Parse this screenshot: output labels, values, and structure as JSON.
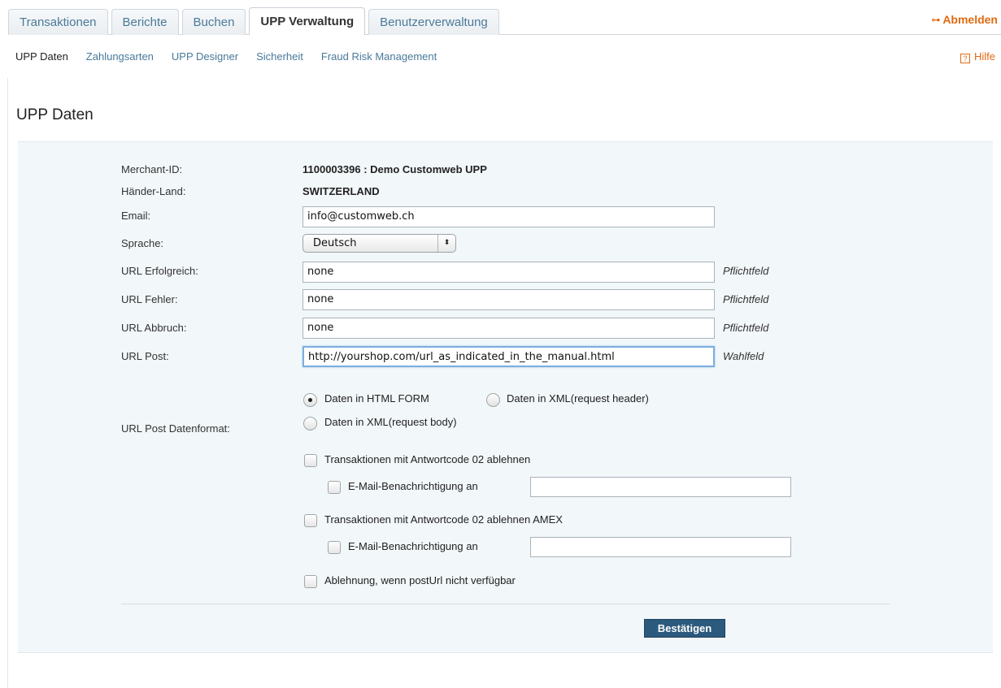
{
  "tabs": [
    "Transaktionen",
    "Berichte",
    "Buchen",
    "UPP Verwaltung",
    "Benutzerverwaltung"
  ],
  "active_tab": "UPP Verwaltung",
  "logout_label": "Abmelden",
  "subnav": [
    "UPP Daten",
    "Zahlungsarten",
    "UPP Designer",
    "Sicherheit",
    "Fraud Risk Management"
  ],
  "active_subnav": "UPP Daten",
  "help_label": "Hilfe",
  "page_title": "UPP Daten",
  "form": {
    "merchant_id_label": "Merchant-ID:",
    "merchant_id_value": "1100003396 : Demo Customweb UPP",
    "country_label": "Händer-Land:",
    "country_value": "SWITZERLAND",
    "email_label": "Email:",
    "email_value": "info@customweb.ch",
    "language_label": "Sprache:",
    "language_value": "Deutsch",
    "url_success_label": "URL Erfolgreich:",
    "url_success_value": "none",
    "url_error_label": "URL Fehler:",
    "url_error_value": "none",
    "url_cancel_label": "URL Abbruch:",
    "url_cancel_value": "none",
    "url_post_label": "URL Post:",
    "url_post_value": "http://yourshop.com/url_as_indicated_in_the_manual.html",
    "required_note": "Pflichtfeld",
    "optional_note": "Wahlfeld",
    "post_format_label": "URL Post Datenformat:",
    "post_format_options": [
      "Daten in HTML FORM",
      "Daten in XML(request header)",
      "Daten in XML(request body)"
    ],
    "post_format_selected": "Daten in HTML FORM",
    "reject_02_label": "Transaktionen mit Antwortcode 02 ablehnen",
    "email_notify_label": "E-Mail-Benachrichtigung an",
    "email_notify_value": "",
    "reject_02_amex_label": "Transaktionen mit Antwortcode 02 ablehnen AMEX",
    "email_notify_amex_label": "E-Mail-Benachrichtigung an",
    "email_notify_amex_value": "",
    "reject_no_posturl_label": "Ablehnung, wenn postUrl nicht verfügbar",
    "submit_label": "Bestätigen"
  }
}
